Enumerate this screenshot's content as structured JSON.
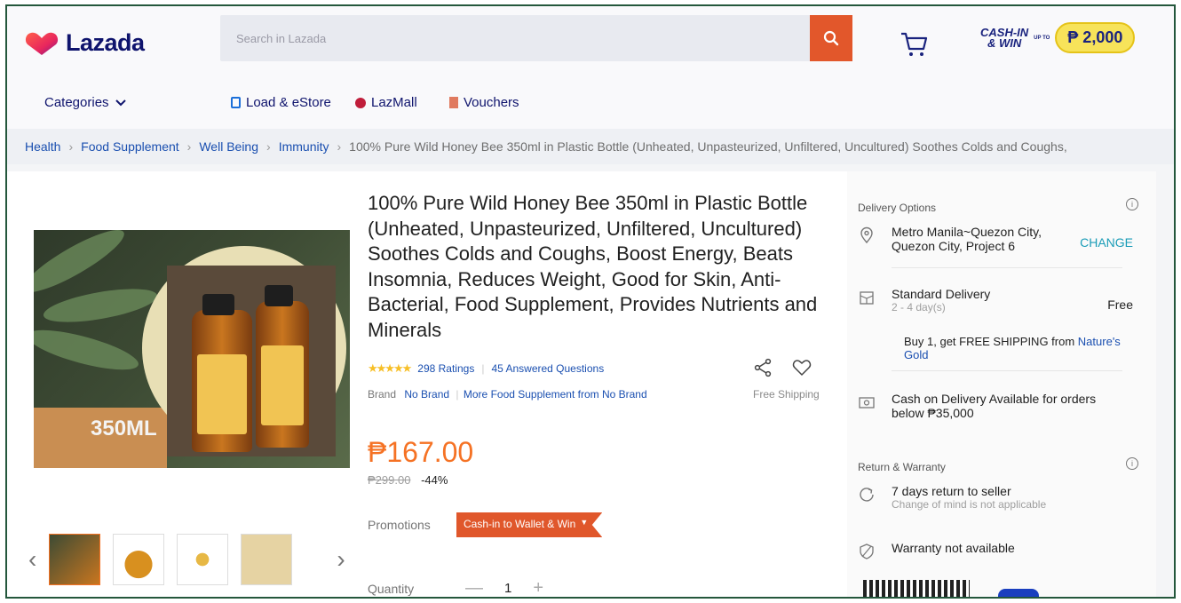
{
  "header": {
    "logo_text": "Lazada",
    "search_placeholder": "Search in Lazada",
    "cashin_line1": "CASH-IN",
    "cashin_line2": "& WIN",
    "cashin_upto": "UP TO",
    "cashin_amount": "₱ 2,000"
  },
  "nav": {
    "categories": "Categories",
    "load_estore": "Load & eStore",
    "lazmall": "LazMall",
    "vouchers": "Vouchers"
  },
  "breadcrumb": [
    "Health",
    "Food Supplement",
    "Well Being",
    "Immunity",
    "100% Pure Wild Honey Bee 350ml in Plastic Bottle (Unheated, Unpasteurized, Unfiltered, Uncultured) Soothes Colds and Coughs,"
  ],
  "product": {
    "title": "100% Pure Wild Honey Bee 350ml in Plastic Bottle (Unheated, Unpasteurized, Unfiltered, Uncultured) Soothes Colds and Coughs, Boost Energy, Beats Insomnia, Reduces Weight, Good for Skin, Anti-Bacterial, Food Supplement, Provides Nutrients and Minerals",
    "image_label": "350ML",
    "stars": "★★★★★",
    "rating_value": 4.5,
    "ratings": "298 Ratings",
    "answered": "45 Answered Questions",
    "brand_label": "Brand",
    "brand_value": "No Brand",
    "more_from": "More Food Supplement from No Brand",
    "free_shipping": "Free Shipping",
    "price": "₱167.00",
    "old_price": "₱299.00",
    "discount": "-44%",
    "promotions_label": "Promotions",
    "promo_tag": "Cash-in to Wallet & Win",
    "quantity_label": "Quantity",
    "quantity_value": "1",
    "qty_minus": "—",
    "qty_plus": "+"
  },
  "delivery": {
    "heading": "Delivery Options",
    "location": "Metro Manila~Quezon City, Quezon City, Project 6",
    "change": "CHANGE",
    "standard_title": "Standard Delivery",
    "standard_days": "2 - 4 day(s)",
    "standard_price": "Free",
    "promo_text": "Buy 1, get FREE SHIPPING from",
    "promo_link": "Nature's Gold",
    "cod": "Cash on Delivery Available for orders below ₱35,000"
  },
  "warranty": {
    "heading": "Return & Warranty",
    "return_title": "7 days return to seller",
    "return_sub": "Change of mind is not applicable",
    "warranty_text": "Warranty not available"
  },
  "colors": {
    "accent": "#f57224",
    "search_button": "#e2572b",
    "brand_navy": "#0f146d",
    "link_blue": "#1a4fb0"
  }
}
